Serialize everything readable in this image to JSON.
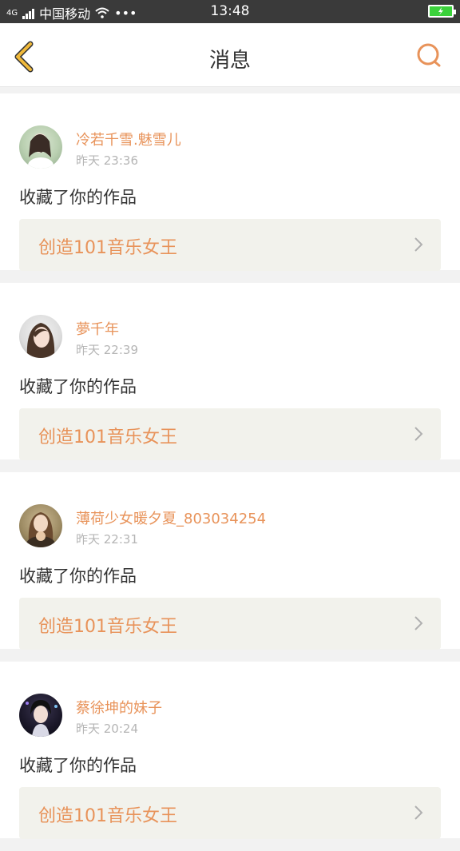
{
  "status_bar": {
    "network": "4G",
    "carrier": "中国移动",
    "more": "•••",
    "time": "13:48"
  },
  "header": {
    "title": "消息"
  },
  "colors": {
    "accent": "#e8935a",
    "back_arrow": "#f0b93a"
  },
  "messages": [
    {
      "username": "冷若千雪.魅雪儿",
      "time": "昨天 23:36",
      "action": "收藏了你的作品",
      "work": "创造101音乐女王"
    },
    {
      "username": "夢千年",
      "time": "昨天 22:39",
      "action": "收藏了你的作品",
      "work": "创造101音乐女王"
    },
    {
      "username": "薄荷少女暖夕夏_803034254",
      "time": "昨天 22:31",
      "action": "收藏了你的作品",
      "work": "创造101音乐女王"
    },
    {
      "username": "蔡徐坤的妹子",
      "time": "昨天 20:24",
      "action": "收藏了你的作品",
      "work": "创造101音乐女王"
    }
  ]
}
